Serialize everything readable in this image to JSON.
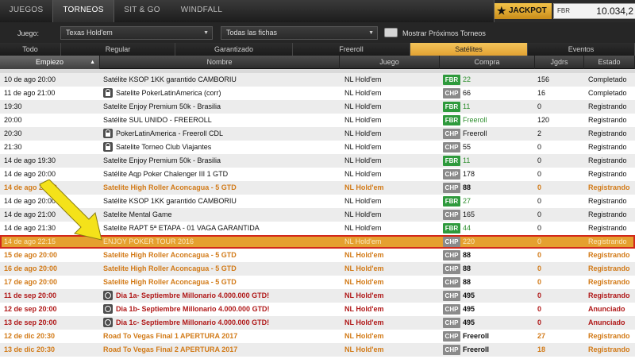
{
  "nav": {
    "tabs": [
      {
        "label": "JUEGOS",
        "active": false
      },
      {
        "label": "TORNEOS",
        "active": true
      },
      {
        "label": "SIT & GO",
        "active": false
      },
      {
        "label": "WINDFALL",
        "active": false
      }
    ],
    "jackpot_label": "JACKPOT",
    "jackpot_currency": "FBR",
    "jackpot_value": "10.034,2"
  },
  "filters": {
    "game_label": "Juego:",
    "game_value": "Texas Hold'em",
    "chips_value": "Todas las fichas",
    "show_next_label": "Mostrar Próximos Torneos"
  },
  "subtabs": [
    {
      "label": "Todo",
      "active": false
    },
    {
      "label": "Regular",
      "active": false
    },
    {
      "label": "Garantizado",
      "active": false
    },
    {
      "label": "Freeroll",
      "active": false
    },
    {
      "label": "Satélites",
      "active": true
    },
    {
      "label": "Eventos",
      "active": false
    }
  ],
  "columns": {
    "start": "Empiezo",
    "name": "Nombre",
    "game": "Juego",
    "buyin": "Compra",
    "players": "Jgdrs",
    "status": "Estado"
  },
  "rows": [
    {
      "start": "10 de ago 20:00",
      "name": "Satélite KSOP 1KK garantido CAMBORIU",
      "icon": "",
      "game": "NL Hold'em",
      "currency": "FBR",
      "buyin": "22",
      "players": "156",
      "status": "Completado",
      "style": "normal"
    },
    {
      "start": "11 de ago 21:00",
      "name": "Satelite PokerLatinAmerica (corr)",
      "icon": "lock",
      "game": "NL Hold'em",
      "currency": "CHP",
      "buyin": "66",
      "players": "16",
      "status": "Completado",
      "style": "normal"
    },
    {
      "start": "19:30",
      "name": "Satelite Enjoy Premium 50k - Brasilia",
      "icon": "",
      "game": "NL Hold'em",
      "currency": "FBR",
      "buyin": "11",
      "players": "0",
      "status": "Registrando",
      "style": "normal"
    },
    {
      "start": "20:00",
      "name": "Satélite SUL UNIDO - FREEROLL",
      "icon": "",
      "game": "NL Hold'em",
      "currency": "FBR",
      "buyin": "Freeroll",
      "players": "120",
      "status": "Registrando",
      "style": "normal"
    },
    {
      "start": "20:30",
      "name": "PokerLatinAmerica - Freeroll CDL",
      "icon": "lock",
      "game": "NL Hold'em",
      "currency": "CHP",
      "buyin": "Freeroll",
      "players": "2",
      "status": "Registrando",
      "style": "normal"
    },
    {
      "start": "21:30",
      "name": "Satelite Torneo Club Viajantes",
      "icon": "lock",
      "game": "NL Hold'em",
      "currency": "CHP",
      "buyin": "55",
      "players": "0",
      "status": "Registrando",
      "style": "normal"
    },
    {
      "start": "14 de ago 19:30",
      "name": "Satelite Enjoy Premium 50k - Brasilia",
      "icon": "",
      "game": "NL Hold'em",
      "currency": "FBR",
      "buyin": "11",
      "players": "0",
      "status": "Registrando",
      "style": "normal"
    },
    {
      "start": "14 de ago 20:00",
      "name": "Satélite Aqp Poker Chalenger III 1 GTD",
      "icon": "",
      "game": "NL Hold'em",
      "currency": "CHP",
      "buyin": "178",
      "players": "0",
      "status": "Registrando",
      "style": "normal"
    },
    {
      "start": "14 de ago 20:00",
      "name": "Satelite High Roller Aconcagua - 5 GTD",
      "icon": "",
      "game": "NL Hold'em",
      "currency": "CHP",
      "buyin": "88",
      "players": "0",
      "status": "Registrando",
      "style": "orange"
    },
    {
      "start": "14 de ago 20:00",
      "name": "Satélite KSOP 1KK garantido CAMBORIU",
      "icon": "",
      "game": "NL Hold'em",
      "currency": "FBR",
      "buyin": "27",
      "players": "0",
      "status": "Registrando",
      "style": "normal"
    },
    {
      "start": "14 de ago 21:00",
      "name": "Satelite Mental Game",
      "icon": "",
      "game": "NL Hold'em",
      "currency": "CHP",
      "buyin": "165",
      "players": "0",
      "status": "Registrando",
      "style": "normal"
    },
    {
      "start": "14 de ago 21:30",
      "name": "Satelite RAPT 5ª ETAPA - 01 VAGA GARANTIDA",
      "icon": "",
      "game": "NL Hold'em",
      "currency": "FBR",
      "buyin": "44",
      "players": "0",
      "status": "Registrando",
      "style": "normal"
    },
    {
      "start": "14 de ago 22:15",
      "name": "ENJOY POKER TOUR 2016",
      "icon": "",
      "game": "NL Hold'em",
      "currency": "CHP",
      "buyin": "220",
      "players": "0",
      "status": "Registrando",
      "style": "highlight"
    },
    {
      "start": "15 de ago 20:00",
      "name": "Satelite High Roller Aconcagua - 5 GTD",
      "icon": "",
      "game": "NL Hold'em",
      "currency": "CHP",
      "buyin": "88",
      "players": "0",
      "status": "Registrando",
      "style": "orange"
    },
    {
      "start": "16 de ago 20:00",
      "name": "Satelite High Roller Aconcagua - 5 GTD",
      "icon": "",
      "game": "NL Hold'em",
      "currency": "CHP",
      "buyin": "88",
      "players": "0",
      "status": "Registrando",
      "style": "orange"
    },
    {
      "start": "17 de ago 20:00",
      "name": "Satelite High Roller Aconcagua - 5 GTD",
      "icon": "",
      "game": "NL Hold'em",
      "currency": "CHP",
      "buyin": "88",
      "players": "0",
      "status": "Registrando",
      "style": "orange"
    },
    {
      "start": "11 de sep 20:00",
      "name": "Dia 1a- Septiembre Millonario 4.000.000 GTD!",
      "icon": "clock",
      "game": "NL Hold'em",
      "currency": "CHP",
      "buyin": "495",
      "players": "0",
      "status": "Registrando",
      "style": "red"
    },
    {
      "start": "12 de sep 20:00",
      "name": "Dia 1b- Septiembre Millonario 4.000.000 GTD!",
      "icon": "clock",
      "game": "NL Hold'em",
      "currency": "CHP",
      "buyin": "495",
      "players": "0",
      "status": "Anunciado",
      "style": "red"
    },
    {
      "start": "13 de sep 20:00",
      "name": "Dia 1c- Septiembre Millonario 4.000.000 GTD!",
      "icon": "clock",
      "game": "NL Hold'em",
      "currency": "CHP",
      "buyin": "495",
      "players": "0",
      "status": "Anunciado",
      "style": "red"
    },
    {
      "start": "12 de dic 20:30",
      "name": "Road To Vegas Final 1 APERTURA 2017",
      "icon": "",
      "game": "NL Hold'em",
      "currency": "CHP",
      "buyin": "Freeroll",
      "players": "27",
      "status": "Registrando",
      "style": "orange"
    },
    {
      "start": "13 de dic 20:30",
      "name": "Road To Vegas Final 2 APERTURA 2017",
      "icon": "",
      "game": "NL Hold'em",
      "currency": "CHP",
      "buyin": "Freeroll",
      "players": "18",
      "status": "Registrando",
      "style": "orange"
    }
  ]
}
